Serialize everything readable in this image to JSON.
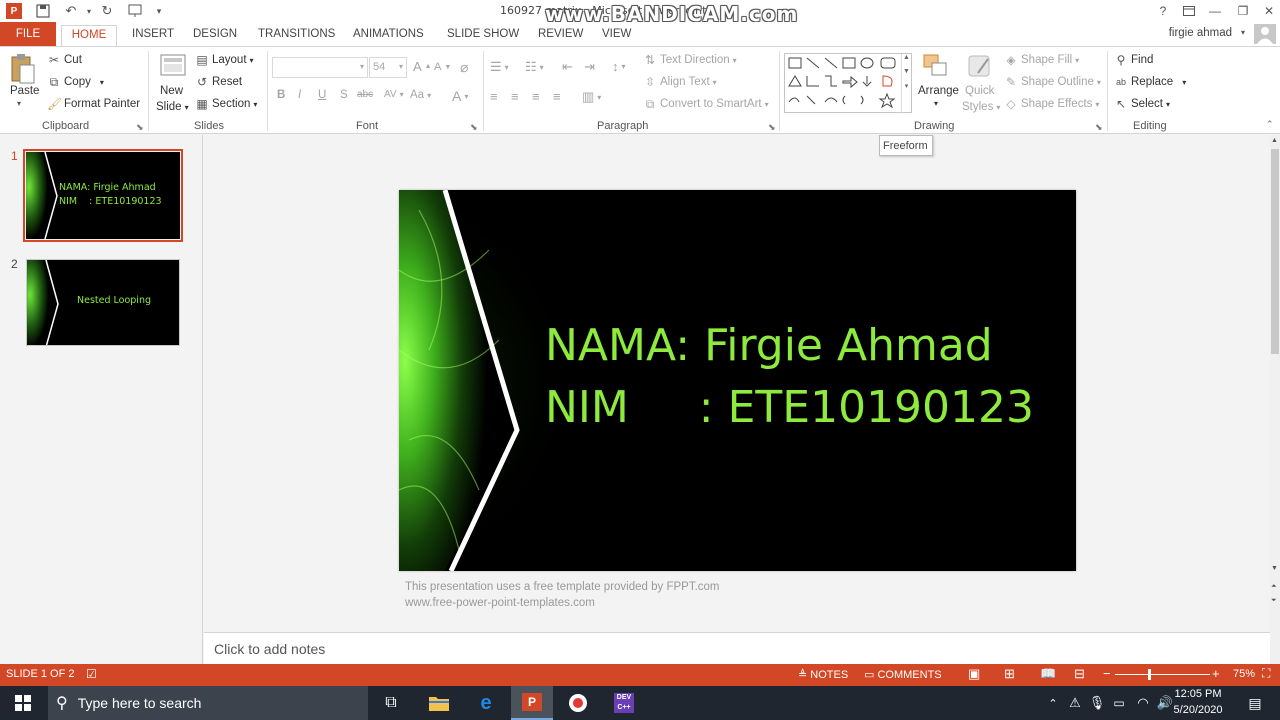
{
  "titlebar": {
    "doc_title": "160927 matrix - Microsoft PowerPoint",
    "watermark": "www.BANDICAM.com",
    "help": "?",
    "minimize": "—",
    "restore": "❐",
    "close": "✕"
  },
  "tabs": {
    "file": "FILE",
    "home": "HOME",
    "insert": "INSERT",
    "design": "DESIGN",
    "transitions": "TRANSITIONS",
    "animations": "ANIMATIONS",
    "slideshow": "SLIDE SHOW",
    "review": "REVIEW",
    "view": "VIEW",
    "user": "firgie ahmad"
  },
  "ribbon": {
    "clipboard": {
      "paste": "Paste",
      "cut": "Cut",
      "copy": "Copy",
      "format_painter": "Format Painter",
      "label": "Clipboard"
    },
    "slides": {
      "new_slide": "New",
      "new_slide2": "Slide",
      "layout": "Layout",
      "reset": "Reset",
      "section": "Section",
      "label": "Slides"
    },
    "font": {
      "size": "54",
      "bold": "B",
      "italic": "I",
      "underline": "U",
      "shadow": "S",
      "strike": "abc",
      "spacing": "AV",
      "case": "Aa",
      "grow": "A",
      "shrink": "A",
      "color": "A",
      "label": "Font"
    },
    "paragraph": {
      "text_direction": "Text Direction",
      "align_text": "Align Text",
      "convert_smartart": "Convert to SmartArt",
      "label": "Paragraph"
    },
    "drawing": {
      "arrange": "Arrange",
      "quick_styles": "Quick",
      "quick_styles2": "Styles",
      "shape_fill": "Shape Fill",
      "shape_outline": "Shape Outline",
      "shape_effects": "Shape Effects",
      "label": "Drawing"
    },
    "editing": {
      "find": "Find",
      "replace": "Replace",
      "select": "Select",
      "label": "Editing"
    }
  },
  "tooltip": "Freeform",
  "thumbnails": [
    {
      "num": "1",
      "line1": "NAMA: Firgie Ahmad",
      "line2": "NIM    : ETE10190123"
    },
    {
      "num": "2",
      "line1": "Nested Looping"
    }
  ],
  "slide": {
    "line1": "NAMA: Firgie Ahmad",
    "line2": "NIM     : ETE10190123"
  },
  "footer": {
    "line1": "This presentation uses a free template provided by FPPT.com",
    "line2": "www.free-power-point-templates.com"
  },
  "notes": {
    "placeholder": "Click to add notes"
  },
  "statusbar": {
    "slide_info": "SLIDE 1 OF 2",
    "notes": "NOTES",
    "comments": "COMMENTS",
    "zoom": "75%"
  },
  "taskbar": {
    "search": "Type here to search",
    "time": "12:05 PM",
    "date": "5/20/2020"
  },
  "colors": {
    "accent": "#d24726",
    "slide_text": "#8eea3c",
    "taskbar": "#1f2630"
  }
}
